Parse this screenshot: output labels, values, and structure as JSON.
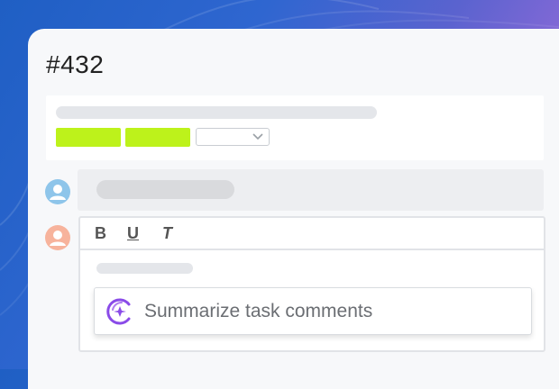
{
  "ticket": {
    "title": "#432"
  },
  "editor": {
    "toolbar": {
      "bold": "B",
      "underline": "U",
      "italic": "T"
    },
    "suggestion": {
      "label": "Summarize task comments",
      "icon": "ai-sparkle-icon"
    }
  },
  "colors": {
    "tag": "#bdf21b",
    "avatar_1": "#8ec5ea",
    "avatar_2": "#f7b39c",
    "ai_accent": "#8a4be8"
  }
}
